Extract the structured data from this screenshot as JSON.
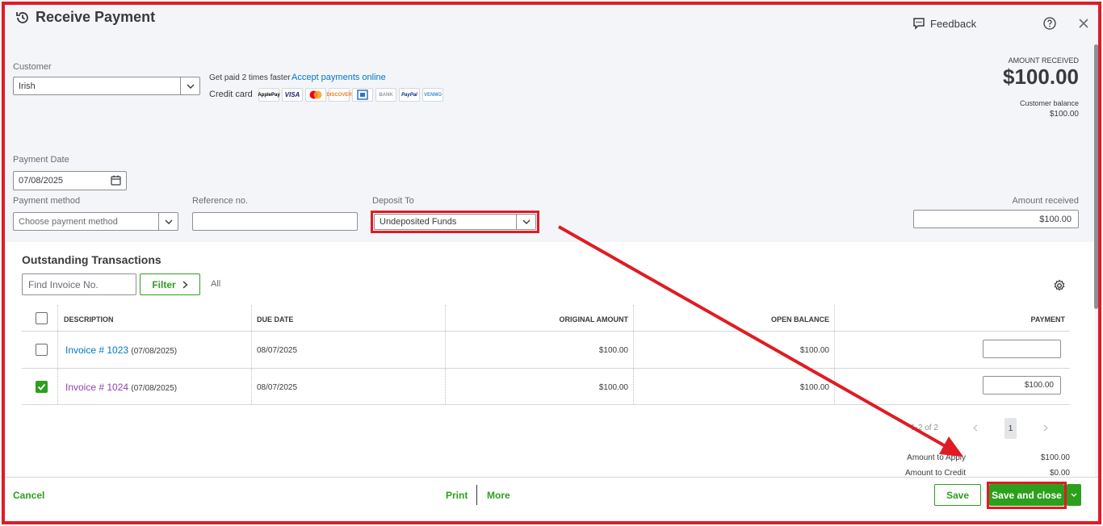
{
  "header": {
    "title": "Receive Payment",
    "feedback_label": "Feedback"
  },
  "customer": {
    "label": "Customer",
    "value": "Irish"
  },
  "promo": {
    "getpaid": "Get paid 2 times faster",
    "accept_link": "Accept payments online",
    "credit_card_label": "Credit card",
    "logos": [
      "ApplePay",
      "VISA",
      "mastercard",
      "DISCOVER",
      "AMEX",
      "BANK",
      "PayPal",
      "VENMO"
    ]
  },
  "amount_summary": {
    "label": "AMOUNT RECEIVED",
    "value": "$100.00",
    "balance_label": "Customer balance",
    "balance_value": "$100.00"
  },
  "payment_date": {
    "label": "Payment Date",
    "value": "07/08/2025"
  },
  "payment_method": {
    "label": "Payment method",
    "placeholder": "Choose payment method"
  },
  "reference": {
    "label": "Reference no.",
    "value": ""
  },
  "deposit_to": {
    "label": "Deposit To",
    "value": "Undeposited Funds"
  },
  "amount_received": {
    "label": "Amount received",
    "value": "$100.00"
  },
  "outstanding": {
    "title": "Outstanding Transactions",
    "find_placeholder": "Find Invoice No.",
    "filter_label": "Filter",
    "all_label": "All",
    "columns": [
      "DESCRIPTION",
      "DUE DATE",
      "ORIGINAL AMOUNT",
      "OPEN BALANCE",
      "PAYMENT"
    ],
    "rows": [
      {
        "checked": false,
        "invoice": "Invoice # 1023",
        "date": "(07/08/2025)",
        "due_date": "08/07/2025",
        "original": "$100.00",
        "open": "$100.00",
        "payment": ""
      },
      {
        "checked": true,
        "invoice": "Invoice # 1024",
        "date": "(07/08/2025)",
        "due_date": "08/07/2025",
        "original": "$100.00",
        "open": "$100.00",
        "payment": "$100.00"
      }
    ],
    "pager_text": "1-2 of 2",
    "page": "1"
  },
  "totals": {
    "apply_label": "Amount to Apply",
    "apply_value": "$100.00",
    "credit_label": "Amount to Credit",
    "credit_value": "$0.00"
  },
  "footer": {
    "cancel": "Cancel",
    "print": "Print",
    "more": "More",
    "save": "Save",
    "save_close": "Save and close"
  },
  "colors": {
    "accent_green": "#2ca01c",
    "link_blue": "#0077c5",
    "visited_purple": "#8e44ad",
    "annotation_red": "#e01b24"
  }
}
